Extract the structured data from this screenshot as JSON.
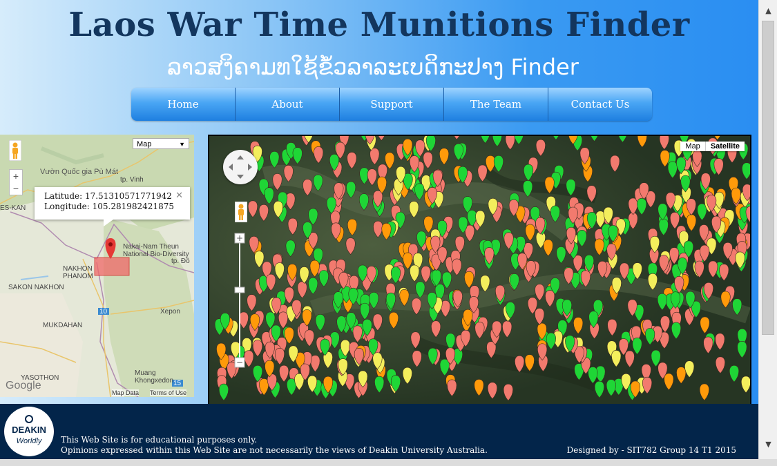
{
  "header": {
    "title": "Laos War Time Munitions Finder",
    "subtitle": "ລາວສງິຄາມທໃຊ້ຂໍ້ວລາລະເບດິກະປາງ Finder"
  },
  "nav": {
    "items": [
      {
        "label": "Home"
      },
      {
        "label": "About"
      },
      {
        "label": "Support"
      },
      {
        "label": "The Team"
      },
      {
        "label": "Contact Us"
      }
    ]
  },
  "small_map": {
    "map_type_select": "Map",
    "zoom_in": "+",
    "zoom_out": "−",
    "info": {
      "latitude_text": "Latitude: 17.51310571771942",
      "longitude_text": "Longitude: 105.281982421875",
      "close": "✕"
    },
    "labels": {
      "vuon": "Vườn Quốc gia Pù Mát",
      "vinh": "tp. Vinh",
      "nakai": "Nakai-Nam Theun\nNational Bio-Diversity",
      "nakhon": "NAKHON\nPHANOM",
      "sakon": "SAKON NAKHON",
      "dong": "tp. Đồ",
      "mukdahan": "MUKDAHAN",
      "xepon": "Xepon",
      "yasothon": "YASOTHON",
      "muang": "Muang\nKhongxedon",
      "r10": "10",
      "r15": "15",
      "kan": "ES-KAN"
    },
    "google": "Google",
    "map_data": "Map Data",
    "terms": "Terms of Use"
  },
  "big_map": {
    "map_button": "Map",
    "satellite_button": "Satellite",
    "zoom_in": "+",
    "zoom_out": "−",
    "colors": {
      "red": "#f27a6e",
      "green": "#1fd636",
      "orange": "#ff9a0a",
      "yellow": "#f3ee5c"
    }
  },
  "footer": {
    "logo_top": "DEAKIN",
    "logo_bottom": "Worldly",
    "disclaimer_1": "This Web Site is for educational purposes only.",
    "disclaimer_2": "Opinions expressed within this Web Site are not necessarily the views of Deakin University Australia.",
    "designed_by": "Designed by - SIT782 Group 14 T1 2015"
  },
  "scrollbar": {
    "up": "▲",
    "down": "▼"
  }
}
